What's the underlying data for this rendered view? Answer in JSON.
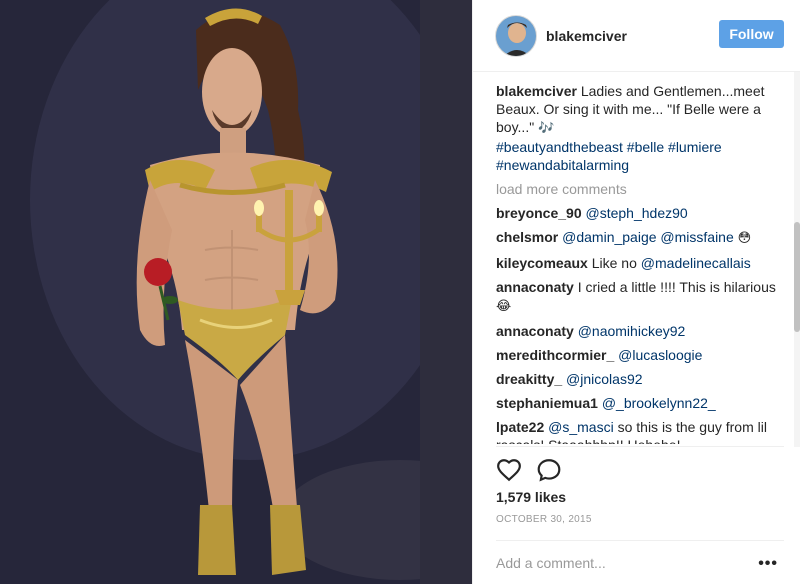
{
  "post": {
    "username": "blakemciver",
    "follow_label": "Follow",
    "caption": {
      "username": "blakemciver",
      "text": " Ladies and Gentlemen...meet Beaux. Or sing it with me... \"If Belle were a boy...\" ",
      "music_emoji": "🎶",
      "hashtags": "#beautyandthebeast #belle #lumiere #newandabitalarming"
    },
    "load_more_label": "load more comments",
    "comments": [
      {
        "user": "breyonce_90",
        "mention": "@steph_hdez90",
        "text": "",
        "emoji": ""
      },
      {
        "user": "chelsmor",
        "mention": "@damin_paige @missfaine",
        "text": "",
        "emoji": "😳"
      },
      {
        "user": "kileycomeaux",
        "mention": "",
        "text": "Like no ",
        "mention_after": "@madelinecallais",
        "emoji": ""
      },
      {
        "user": "annaconaty",
        "mention": "",
        "text": "I cried a little !!!! This is hilarious ",
        "emoji": "😂"
      },
      {
        "user": "annaconaty",
        "mention": "@naomihickey92",
        "text": "",
        "emoji": ""
      },
      {
        "user": "meredithcormier_",
        "mention": "@lucasloogie",
        "text": "",
        "emoji": ""
      },
      {
        "user": "dreakitty_",
        "mention": "@jnicolas92",
        "text": "",
        "emoji": ""
      },
      {
        "user": "stephaniemua1",
        "mention": "@_brookelynn22_",
        "text": "",
        "emoji": ""
      },
      {
        "user": "lpate22",
        "mention": "@s_masci",
        "text": " so this is the guy from lil rascals! Staaahhhp!! Hehehe!",
        "emoji": ""
      }
    ],
    "likes": "1,579 likes",
    "date": "OCTOBER 30, 2015",
    "add_comment_placeholder": "Add a comment...",
    "more_label": "•••",
    "icons": [
      "heart-icon",
      "comment-icon",
      "more-options-icon"
    ],
    "colors": {
      "follow": "#5da1e6",
      "link": "#003569",
      "muted": "#999999"
    }
  }
}
